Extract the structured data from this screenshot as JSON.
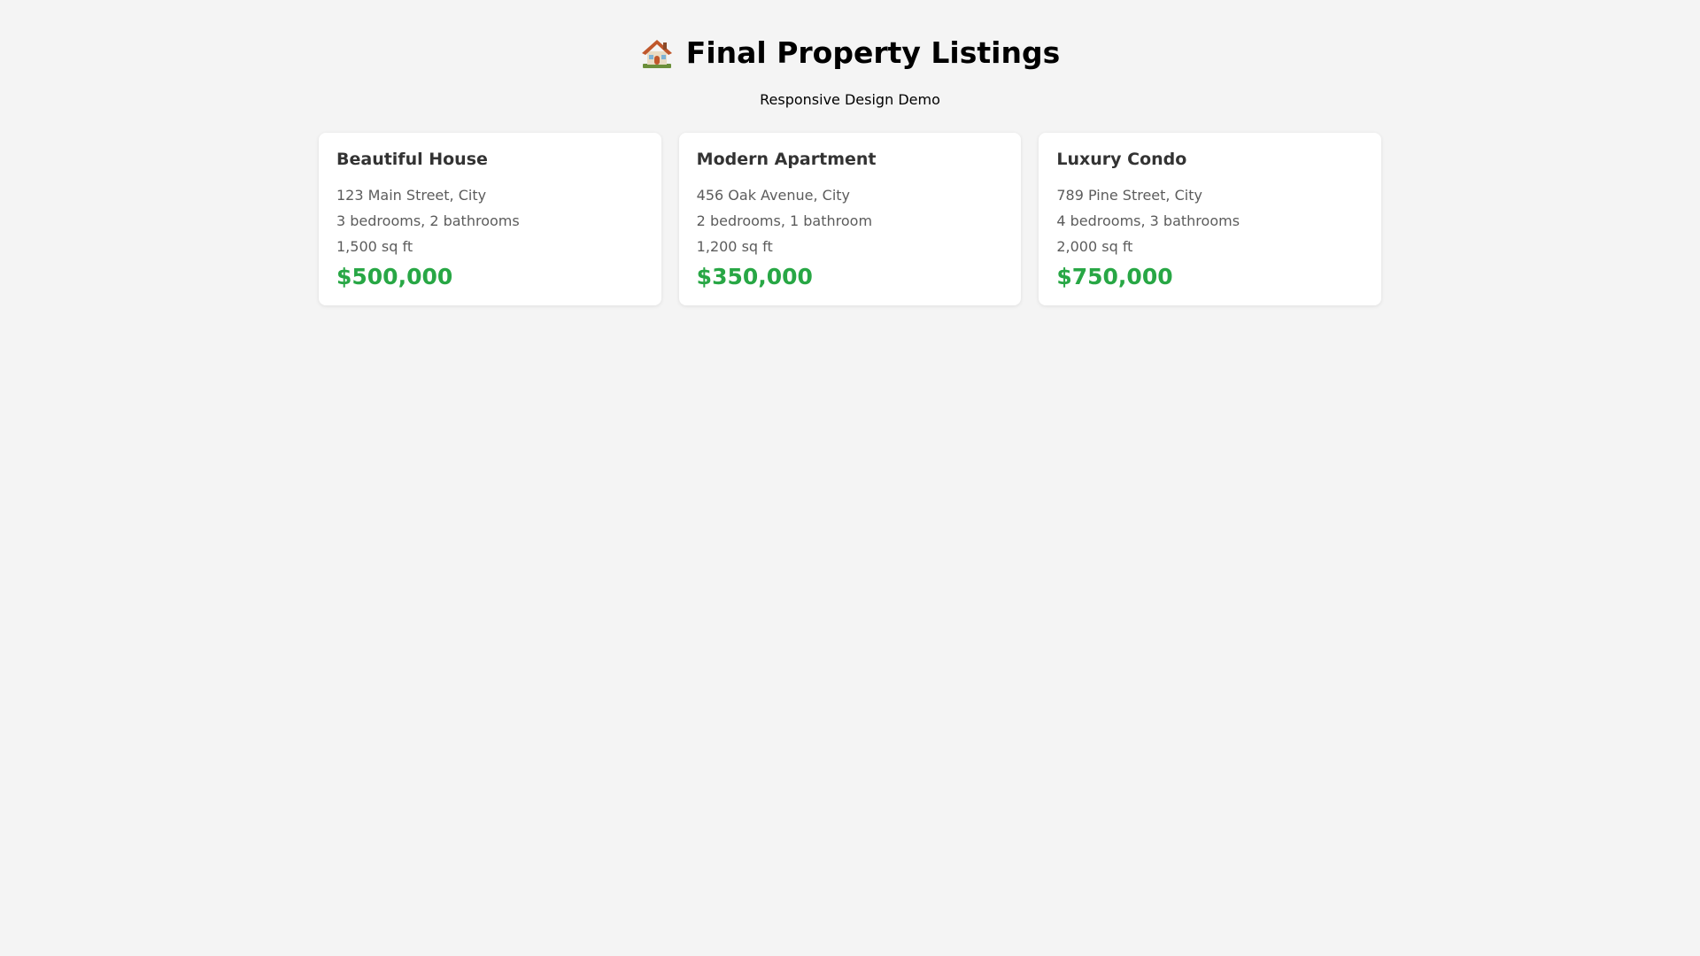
{
  "header": {
    "icon": "house-icon",
    "title": "Final Property Listings",
    "subtitle": "Responsive Design Demo"
  },
  "colors": {
    "background": "#f4f4f4",
    "card": "#ffffff",
    "price": "#28a745",
    "card_title": "#333333",
    "card_text": "#5c5c5c"
  },
  "listings": [
    {
      "title": "Beautiful House",
      "address": "123 Main Street, City",
      "rooms": "3 bedrooms, 2 bathrooms",
      "area": "1,500 sq ft",
      "price": "$500,000"
    },
    {
      "title": "Modern Apartment",
      "address": "456 Oak Avenue, City",
      "rooms": "2 bedrooms, 1 bathroom",
      "area": "1,200 sq ft",
      "price": "$350,000"
    },
    {
      "title": "Luxury Condo",
      "address": "789 Pine Street, City",
      "rooms": "4 bedrooms, 3 bathrooms",
      "area": "2,000 sq ft",
      "price": "$750,000"
    }
  ]
}
